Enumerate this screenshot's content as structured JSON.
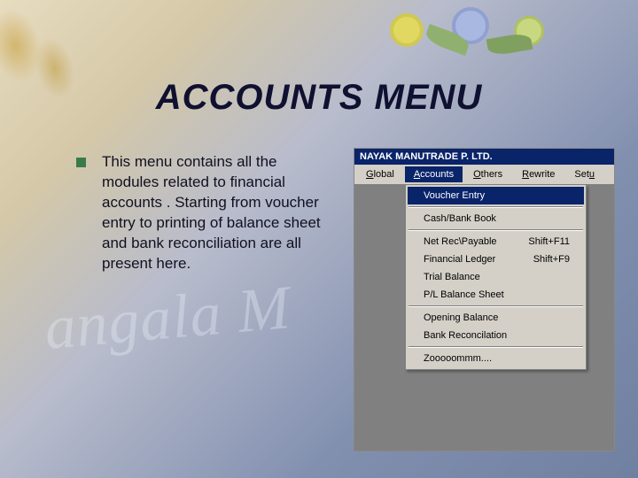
{
  "slide": {
    "title": "ACCOUNTS MENU",
    "bullet_text": "This menu contains all the modules related to financial accounts . Starting from voucher entry to printing of balance sheet and bank reconciliation are all present here.",
    "watermark": "angala   M"
  },
  "app": {
    "title": "NAYAK MANUTRADE P. LTD.",
    "menubar": [
      {
        "label": "Global",
        "underline_index": 0,
        "active": false
      },
      {
        "label": "Accounts",
        "underline_index": 0,
        "active": true
      },
      {
        "label": "Others",
        "underline_index": 0,
        "active": false
      },
      {
        "label": "Rewrite",
        "underline_index": 0,
        "active": false
      },
      {
        "label": "Setu",
        "underline_index": 3,
        "active": false
      }
    ],
    "dropdown": {
      "groups": [
        [
          {
            "label": "Voucher Entry",
            "shortcut": "",
            "highlight": true
          }
        ],
        [
          {
            "label": "Cash/Bank Book",
            "shortcut": ""
          }
        ],
        [
          {
            "label": "Net Rec\\Payable",
            "shortcut": "Shift+F11"
          },
          {
            "label": "Financial Ledger",
            "shortcut": "Shift+F9"
          },
          {
            "label": "Trial Balance",
            "shortcut": ""
          },
          {
            "label": "P/L Balance Sheet",
            "shortcut": ""
          }
        ],
        [
          {
            "label": "Opening Balance",
            "shortcut": ""
          },
          {
            "label": "Bank Reconcilation",
            "shortcut": ""
          }
        ],
        [
          {
            "label": "Zooooommm....",
            "shortcut": ""
          }
        ]
      ]
    }
  }
}
